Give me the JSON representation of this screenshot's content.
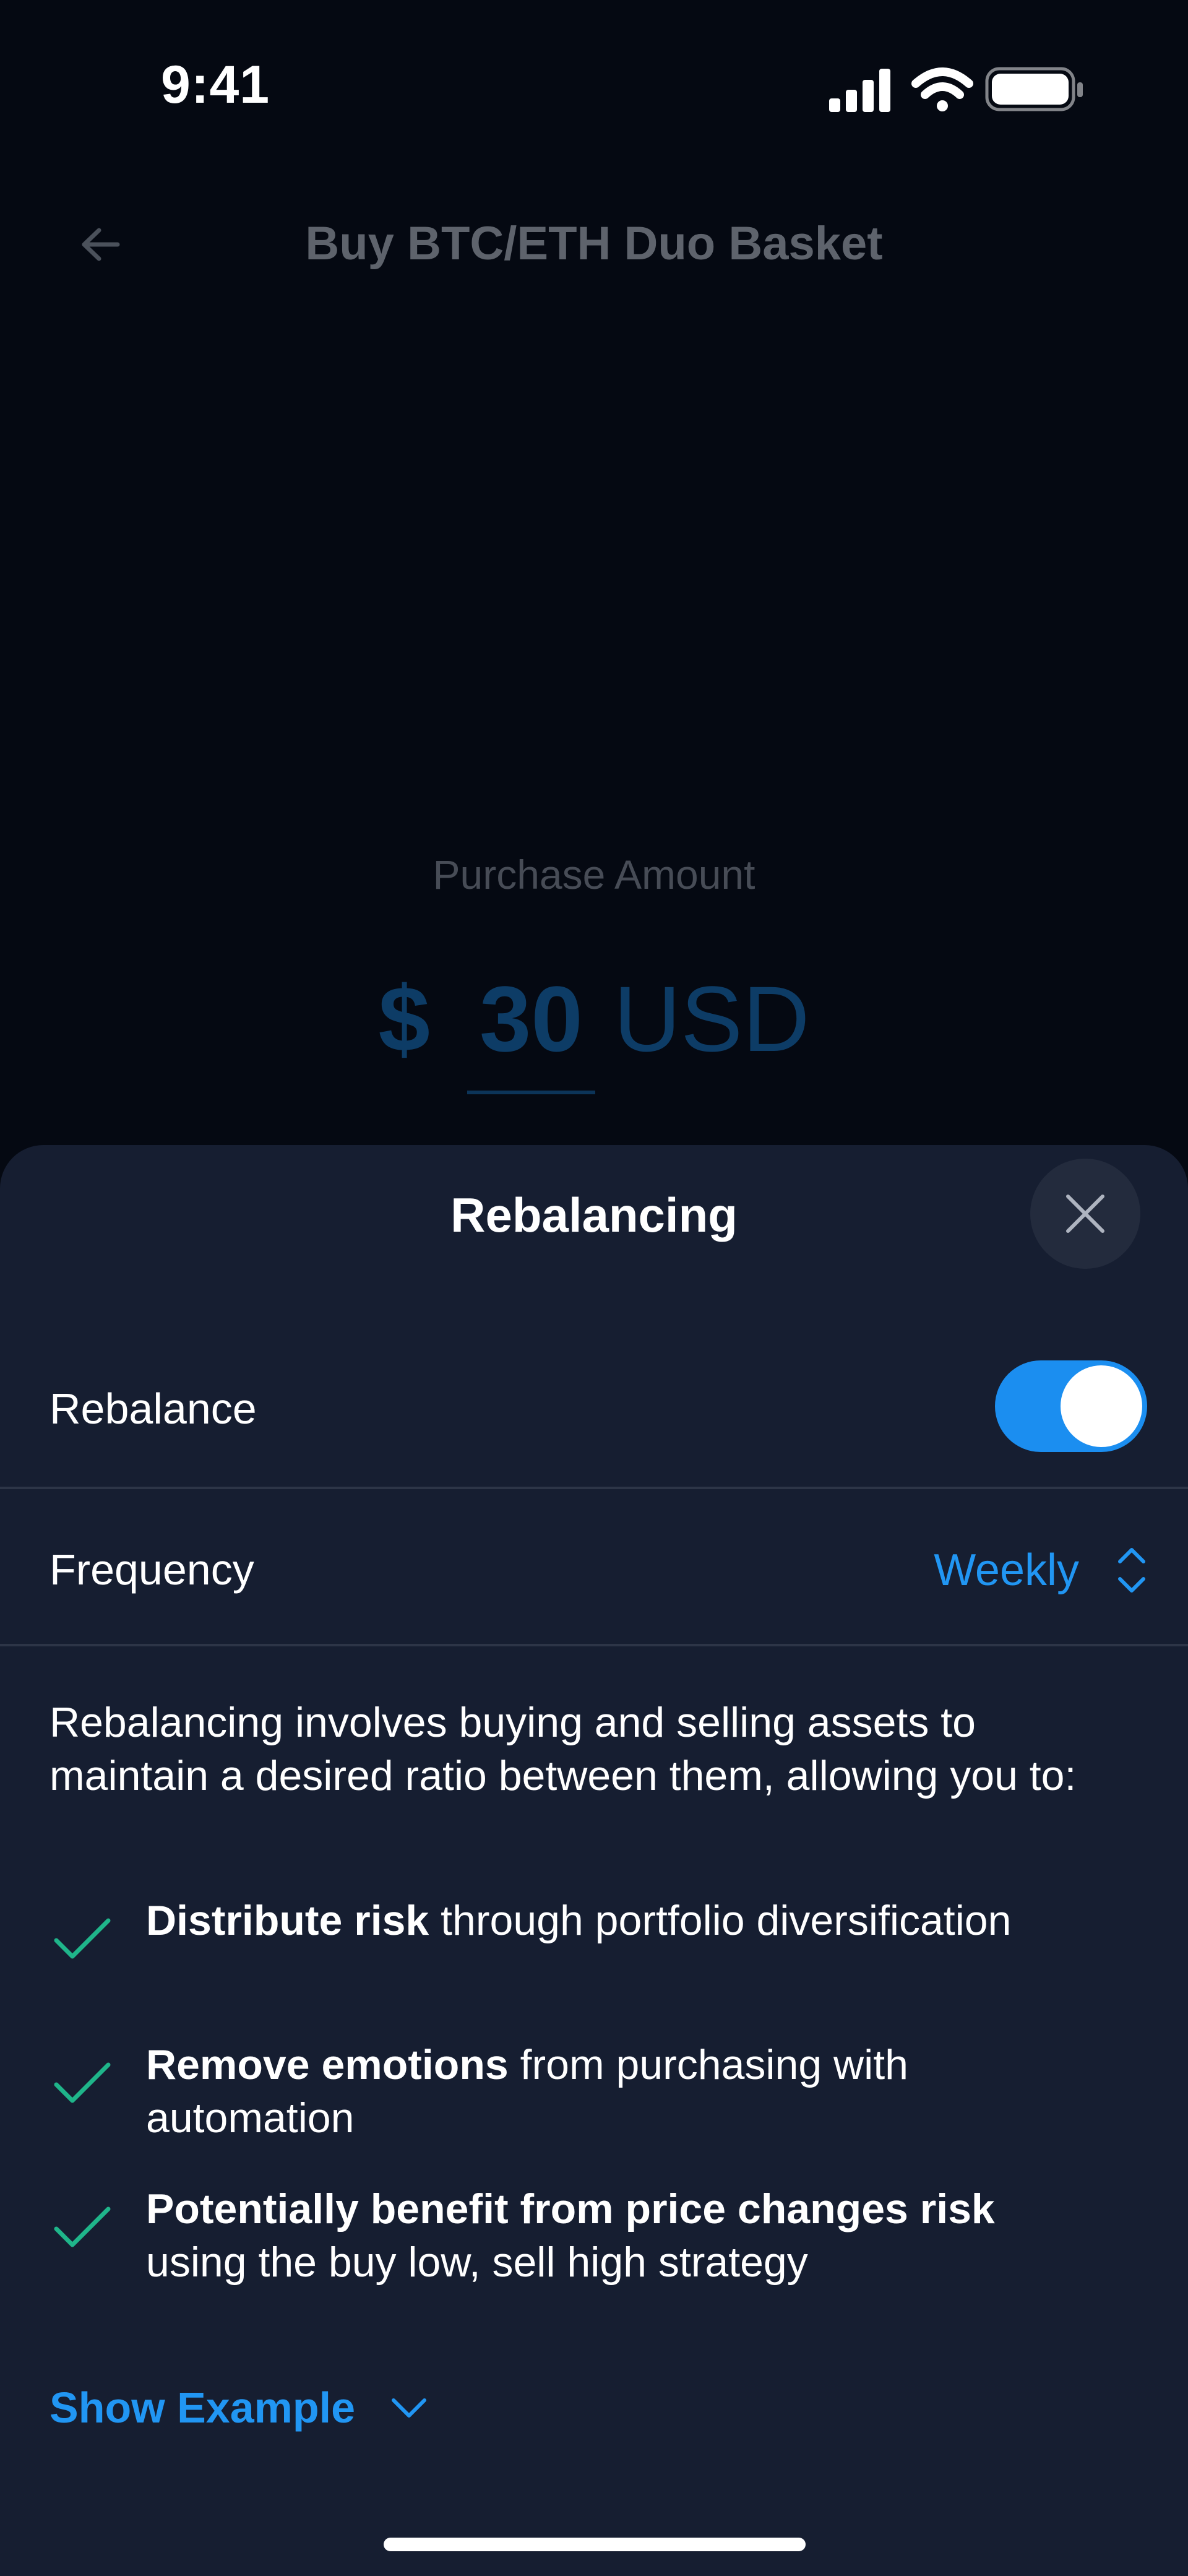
{
  "status_bar": {
    "time": "9:41"
  },
  "background_page": {
    "title": "Buy BTC/ETH Duo Basket",
    "purchase_label": "Purchase Amount",
    "currency_symbol": "$",
    "amount": "30",
    "currency_code": "USD"
  },
  "sheet": {
    "title": "Rebalancing",
    "rebalance_label": "Rebalance",
    "rebalance_enabled": true,
    "frequency_label": "Frequency",
    "frequency_value": "Weekly",
    "description": "Rebalancing involves buying and selling assets to maintain a desired ratio between them, allowing you to:",
    "benefits": [
      {
        "bold": "Distribute risk",
        "rest": "through portfolio diversification"
      },
      {
        "bold": "Remove emotions",
        "rest": "from purchasing with automation"
      },
      {
        "bold": "Potentially benefit from price changes risk",
        "rest": "using the buy low, sell high strategy"
      }
    ],
    "show_example_label": "Show Example"
  },
  "colors": {
    "accent": "#2196f3",
    "check": "#1fb58a",
    "sheet_background": "#161e31"
  },
  "icons": [
    "cellular-signal-icon",
    "wifi-icon",
    "battery-icon",
    "back-arrow-icon",
    "close-icon",
    "sort-chevrons-icon",
    "checkmark-icon",
    "chevron-down-icon"
  ]
}
